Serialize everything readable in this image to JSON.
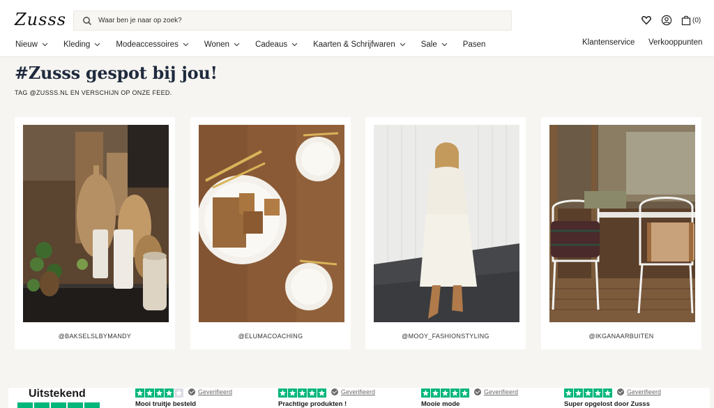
{
  "header": {
    "logo": "Zusss",
    "search_placeholder": "Waar ben je naar op zoek?",
    "cart_count": "(0)"
  },
  "nav": {
    "items": [
      {
        "label": "Nieuw",
        "has_dropdown": true
      },
      {
        "label": "Kleding",
        "has_dropdown": true
      },
      {
        "label": "Modeaccessoires",
        "has_dropdown": true
      },
      {
        "label": "Wonen",
        "has_dropdown": true
      },
      {
        "label": "Cadeaus",
        "has_dropdown": true
      },
      {
        "label": "Kaarten & Schrijfwaren",
        "has_dropdown": true
      },
      {
        "label": "Sale",
        "has_dropdown": true
      },
      {
        "label": "Pasen",
        "has_dropdown": false
      }
    ],
    "right": [
      "Klantenservice",
      "Verkooppunten"
    ]
  },
  "feed": {
    "title": "#Zusss gespot bij jou!",
    "subtitle": "TAG @ZUSSS.NL EN VERSCHIJN OP ONZE FEED.",
    "posts": [
      {
        "handle": "@BAKSELSLBYMANDY"
      },
      {
        "handle": "@ELUMACOACHING"
      },
      {
        "handle": "@MOOY_FASHIONSTYLING"
      },
      {
        "handle": "@IKGANAARBUITEN"
      }
    ]
  },
  "reviews": {
    "rating_label": "Uitstekend",
    "items": [
      {
        "stars": 4,
        "verified": "Geverifieerd",
        "title": "Mooi truitje besteld"
      },
      {
        "stars": 5,
        "verified": "Geverifieerd",
        "title": "Prachtige produkten !"
      },
      {
        "stars": 5,
        "verified": "Geverifieerd",
        "title": "Mooie mode"
      },
      {
        "stars": 5,
        "verified": "Geverifieerd",
        "title": "Super opgelost door Zusss"
      }
    ]
  },
  "colors": {
    "trustpilot_green": "#00b67a",
    "title_navy": "#1f2a3d",
    "page_bg": "#f6f5f1"
  }
}
